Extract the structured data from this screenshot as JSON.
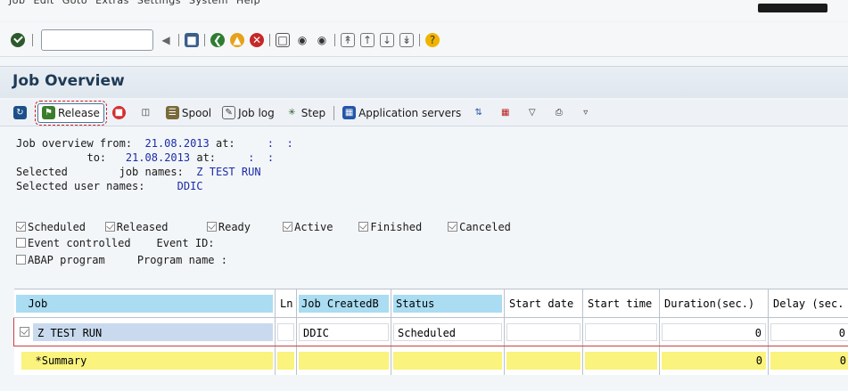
{
  "title": "Job Overview",
  "app_toolbar": {
    "release": "Release",
    "spool": "Spool",
    "job_log": "Job log",
    "step": "Step",
    "application_servers": "Application servers"
  },
  "criteria": {
    "from_label": "Job overview from:",
    "from_date": "21.08.2013",
    "at1": "at:",
    "from_time": ":  :",
    "to_label": "to:",
    "to_date": "21.08.2013",
    "at2": "at:",
    "to_time": ":  :",
    "selected_label": "Selected",
    "jobnames_label": "job names:",
    "job_names": "Z TEST RUN",
    "usernames_label": "Selected user names:",
    "user_names": "DDIC"
  },
  "status_filters": {
    "scheduled": "Scheduled",
    "released": "Released",
    "ready": "Ready",
    "active": "Active",
    "finished": "Finished",
    "canceled": "Canceled"
  },
  "event": {
    "label": "Event controlled",
    "id_label": "Event ID:"
  },
  "abap": {
    "label": "ABAP program",
    "name_label": "Program name :"
  },
  "grid": {
    "columns": [
      "Job",
      "Ln",
      "Job CreatedB",
      "Status",
      "Start date",
      "Start time",
      "Duration(sec.)",
      "Delay (sec."
    ],
    "rows": [
      {
        "job": "Z TEST RUN",
        "created_by": "DDIC",
        "status": "Scheduled",
        "duration": "0",
        "delay": "0"
      }
    ],
    "summary": {
      "label": "*Summary",
      "duration": "0",
      "delay": "0"
    }
  },
  "colors": {
    "header": "#aadcf2",
    "job_cell": "#c9daee",
    "summary": "#faf37d",
    "title_text": "#1f3a55"
  }
}
